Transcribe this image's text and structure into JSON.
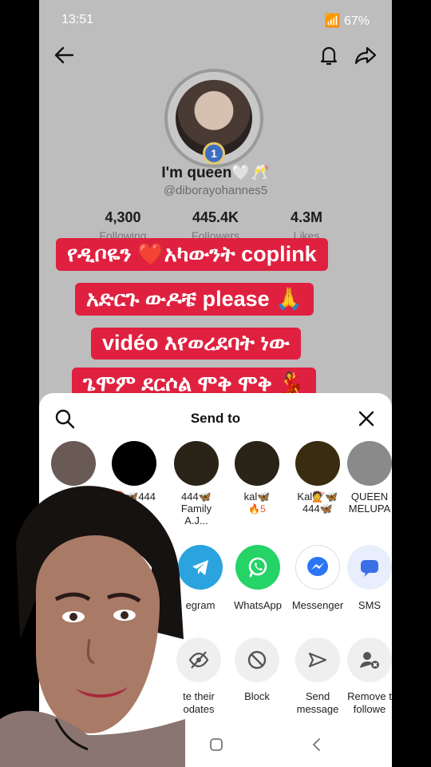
{
  "status_bar": {
    "time": "13:51",
    "battery": "67%"
  },
  "profile": {
    "name": "I'm queen🤍🥂",
    "handle": "@diborayohannes5",
    "rank_badge": "1",
    "stats": [
      {
        "value": "4,300",
        "label": "Following"
      },
      {
        "value": "445.4K",
        "label": "Followers"
      },
      {
        "value": "4.3M",
        "label": "Likes"
      }
    ]
  },
  "caption_lines": [
    "የዲቦዬን ❤️አካውንት coplink",
    "አድርጉ ውዶቼ please 🙏",
    "vidéo እየወረደባት ነው",
    "ጌሞም ደርሶል ሞቅ ሞቅ 💃"
  ],
  "sheet": {
    "title": "Send to",
    "contacts": [
      {
        "name": "",
        "sub": ""
      },
      {
        "name": "♉🦋444",
        "sub": ""
      },
      {
        "name": "444🦋 Family A.J...",
        "sub": ""
      },
      {
        "name": "kal🦋",
        "sub": "🔥5"
      },
      {
        "name": "Kal💇🦋 444🦋",
        "sub": ""
      },
      {
        "name": "QUEEN MELUPA",
        "sub": ""
      }
    ],
    "share_targets": [
      {
        "label": "egram",
        "icon": "telegram-icon",
        "color": "#2aa3df"
      },
      {
        "label": "WhatsApp",
        "icon": "whatsapp-icon",
        "color": "#25d366"
      },
      {
        "label": "Messenger",
        "icon": "messenger-icon",
        "color": "#ffffff"
      },
      {
        "label": "SMS",
        "icon": "sms-icon",
        "color": "#e8eefc"
      }
    ],
    "actions": [
      {
        "label": "te their\nodates",
        "icon": "hide-icon"
      },
      {
        "label": "Block",
        "icon": "block-icon"
      },
      {
        "label": "Send\nmessage",
        "icon": "send-icon"
      },
      {
        "label": "Remove t\nfollowe",
        "icon": "remove-follower-icon"
      }
    ]
  }
}
